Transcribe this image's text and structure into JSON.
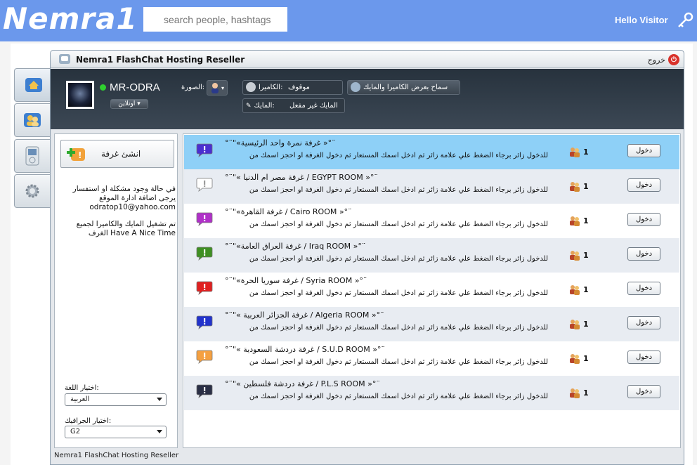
{
  "header": {
    "logo": "Nemra1",
    "search_placeholder": "search people, hashtags",
    "greeting": "Hello Visitor"
  },
  "window": {
    "title": "Nemra1 FlashChat Hosting Reseller",
    "exit_label": "خروج",
    "footer": "Nemra1 FlashChat Hosting Reseller"
  },
  "user": {
    "name": "MR-ODRA",
    "status": "اونلاين",
    "photo_label": "الصورة:",
    "camera_label": "الكاميرا:",
    "camera_value": "موقوف",
    "mic_label": "المايك:",
    "mic_value": "المايك غير مفعل",
    "allow_camera_label": "سماح بعرض الكاميرا والمايك"
  },
  "sidebar": {
    "create_room_label": "انشئ غرفة",
    "info_1": "في حالة وجود مشكلة او استفسار يرجى اضافة ادارة الموقع odratop10@yahoo.com",
    "info_2": "تم تشغيل المايك والكاميرا لجميع الغرف Have A Nice Time",
    "language_label": "اختيار اللغة:",
    "language_value": "العربية",
    "graphics_label": "اختيار الجرافيك:",
    "graphics_value": "G2"
  },
  "rooms": [
    {
      "title": "°¨\"«غرفة نمرة واحد الرئيسية »°¨",
      "desc": "للدخول زائر برجاء الضغط علي علامة زائر ثم ادخل اسمك المستعار ثم دخول الغرفة او احجز اسمك من",
      "count": "1",
      "enter": "دخول",
      "icon_color": "#4a2fd0"
    },
    {
      "title": "°¨\"« غرفة مصر ام الدنيا / EGYPT ROOM »°¨",
      "desc": "للدخول زائر برجاء الضغط علي علامة زائر ثم ادخل اسمك المستعار ثم دخول الغرفة او احجز اسمك من",
      "count": "1",
      "enter": "دخول",
      "icon_color": "#ffffff"
    },
    {
      "title": "°¨\"«غرفة القاهرة / Cairo ROOM »°¨",
      "desc": "للدخول زائر برجاء الضغط علي علامة زائر ثم ادخل اسمك المستعار ثم دخول الغرفة او احجز اسمك من",
      "count": "1",
      "enter": "دخول",
      "icon_color": "#b030c8"
    },
    {
      "title": "°¨\"«غرفة العراق العامة / Iraq ROOM »°¨",
      "desc": "للدخول زائر برجاء الضغط علي علامة زائر ثم ادخل اسمك المستعار ثم دخول الغرفة او احجز اسمك من",
      "count": "1",
      "enter": "دخول",
      "icon_color": "#3f8f22"
    },
    {
      "title": "°¨\"«غرفة سوريا الحرة / Syria ROOM »°¨",
      "desc": "للدخول زائر برجاء الضغط علي علامة زائر ثم ادخل اسمك المستعار ثم دخول الغرفة او احجز اسمك من",
      "count": "1",
      "enter": "دخول",
      "icon_color": "#e02020"
    },
    {
      "title": "°¨\"« غرفة الجزائر العربية / Algeria ROOM »°¨",
      "desc": "للدخول زائر برجاء الضغط علي علامة زائر ثم ادخل اسمك المستعار ثم دخول الغرفة او احجز اسمك من",
      "count": "1",
      "enter": "دخول",
      "icon_color": "#2233cc"
    },
    {
      "title": "°¨\"« غرفة دردشة السعودية / S.U.D ROOM »°¨",
      "desc": "للدخول زائر برجاء الضغط علي علامة زائر ثم ادخل اسمك المستعار ثم دخول الغرفة او احجز اسمك من",
      "count": "1",
      "enter": "دخول",
      "icon_color": "#f5a040"
    },
    {
      "title": "°¨\"« غرفة دردشة فلسطين / P.L.S ROOM »°¨",
      "desc": "للدخول زائر برجاء الضغط علي علامة زائر ثم ادخل اسمك المستعار ثم دخول الغرفة او احجز اسمك من",
      "count": "1",
      "enter": "دخول",
      "icon_color": "#2a2f45"
    }
  ]
}
